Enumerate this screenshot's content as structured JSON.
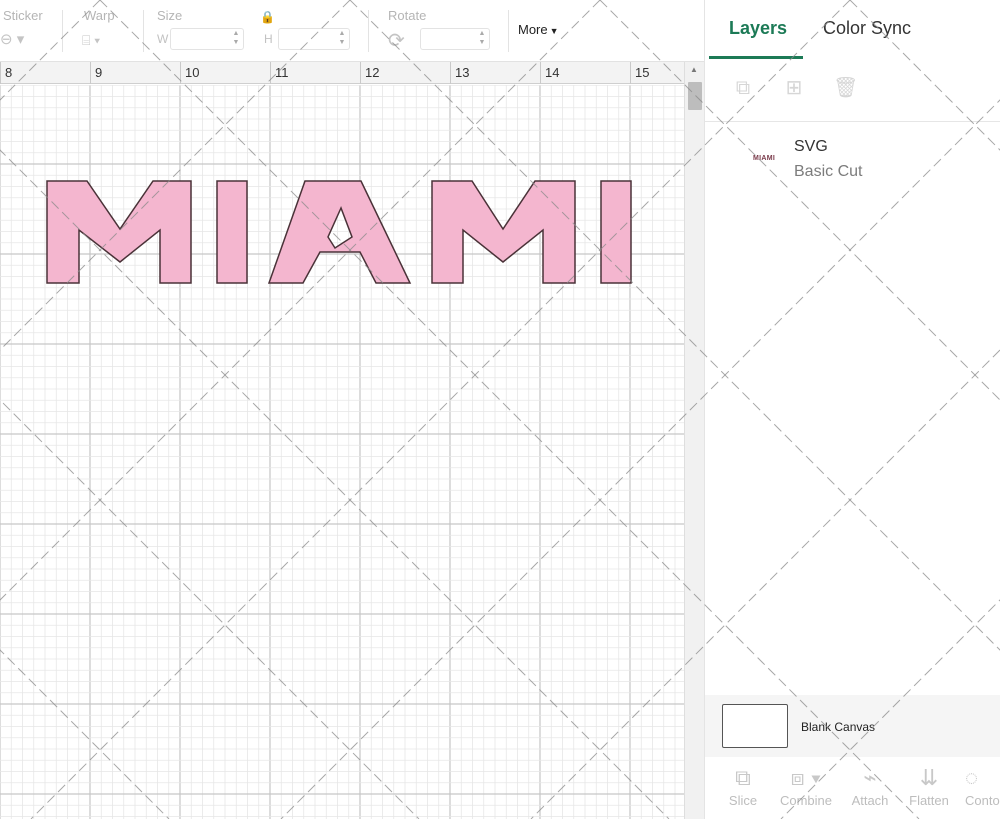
{
  "toolbar": {
    "sticker_label": "Sticker",
    "warp_label": "Warp",
    "size_label": "Size",
    "size_w_prefix": "W",
    "size_h_prefix": "H",
    "rotate_label": "Rotate",
    "more_label": "More"
  },
  "ruler": {
    "numbers": [
      "8",
      "9",
      "10",
      "11",
      "12",
      "13",
      "14",
      "15"
    ]
  },
  "design": {
    "text": "MIAMI",
    "fill_color": "#f4b6cf",
    "stroke_color": "#4a3238"
  },
  "panel": {
    "tabs": [
      {
        "label": "Layers",
        "active": true
      },
      {
        "label": "Color Sync",
        "active": false
      }
    ],
    "layer": {
      "thumb_text": "MIAMI",
      "name": "SVG",
      "operation": "Basic Cut"
    },
    "blank_canvas_label": "Blank Canvas",
    "bottom_tools": [
      {
        "label": "Slice",
        "icon": "slice-icon"
      },
      {
        "label": "Combine",
        "icon": "combine-icon"
      },
      {
        "label": "Attach",
        "icon": "attach-icon"
      },
      {
        "label": "Flatten",
        "icon": "flatten-icon"
      },
      {
        "label": "Conto",
        "icon": "contour-icon"
      }
    ]
  },
  "colors": {
    "accent": "#1c7a56"
  }
}
